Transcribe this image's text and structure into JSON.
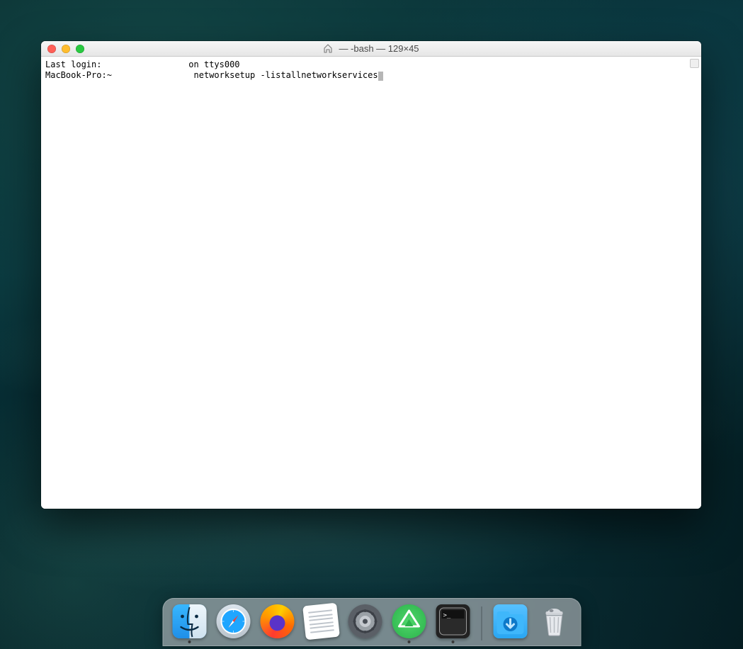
{
  "window": {
    "title": "— -bash — 129×45",
    "home_icon": "home-icon"
  },
  "terminal": {
    "line1": "Last login:                 on ttys000",
    "line2_prompt": "MacBook-Pro:~               ",
    "line2_cmd": " networksetup -listallnetworkservices"
  },
  "dock": {
    "items": [
      {
        "name": "finder",
        "running": true
      },
      {
        "name": "safari",
        "running": false
      },
      {
        "name": "firefox",
        "running": false
      },
      {
        "name": "textedit",
        "running": false
      },
      {
        "name": "settings",
        "running": false
      },
      {
        "name": "proton",
        "running": true
      },
      {
        "name": "terminal",
        "running": true
      }
    ],
    "right": [
      {
        "name": "downloads",
        "running": false
      },
      {
        "name": "trash",
        "running": false
      }
    ]
  }
}
